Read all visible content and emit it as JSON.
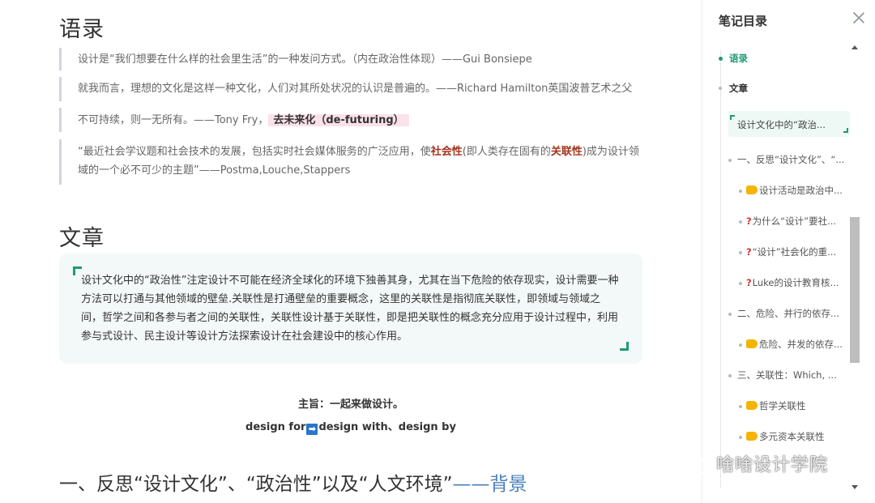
{
  "main": {
    "heading_quotes": "语录",
    "quotes": [
      {
        "text": "设计是“我们想要在什么样的社会里生活”的一种发问方式。（内在政治性体现）——Gui Bonsiepe"
      },
      {
        "text": "就我而言，理想的文化是这样一种文化，人们对其所处状况的认识是普遍的。——Richard Hamilton英国波普艺术之父"
      },
      {
        "pre": "不可持续，则一无所有。——Tony Fry，",
        "highlight": "去未来化（de-futuring）"
      },
      {
        "p1": "“最近社会学议题和社会技术的发展，包括实时社会媒体服务的广泛应用，使",
        "h1": "社会性",
        "p2": "(即人类存在固有的",
        "h2": "关联性",
        "p3": ")成为设计领域的一个必不可少的主题”——Postma,Louche,Stappers"
      }
    ],
    "heading_article": "文章",
    "callout_text": "设计文化中的“政治性”注定设计不可能在经济全球化的环境下独善其身，尤其在当下危险的依存现实，设计需要一种方法可以打通与其他领域的壁垒.关联性是打通壁垒的重要概念，这里的关联性是指彻底关联性，即领域与领域之间，哲学之间和各参与者之间的关联性，关联性设计基于关联性，即是把关联性的概念充分应用于设计过程中，利用参与式设计、民主设计等设计方法探索设计在社会建设中的核心作用。",
    "theme_line": "主旨：一起来做设计。",
    "design_for": "design for",
    "design_arrow": "➡",
    "design_rest": "design with、design by",
    "section_heading": "一、反思“设计文化”、“政治性”以及“人文环境”",
    "section_heading_accent": "——背景"
  },
  "sidebar": {
    "title": "笔记目录",
    "items": [
      {
        "label": "语录",
        "state": "active"
      },
      {
        "label": "文章",
        "state": "bold"
      },
      {
        "label": "设计文化中的“政治..."
      },
      {
        "label": "一、反思“设计文化”、“..."
      },
      {
        "icon": "pointing-hand-icon",
        "label": "设计活动是政治中..."
      },
      {
        "icon": "question-mark-icon",
        "label": "为什么“设计”要社..."
      },
      {
        "icon": "question-mark-icon",
        "label": "“设计”社会化的重..."
      },
      {
        "icon": "question-mark-icon",
        "label": "Luke的设计教育核..."
      },
      {
        "label": "二、危险、并行的依存..."
      },
      {
        "icon": "pointing-hand-icon",
        "label": "危险、并发的依存..."
      },
      {
        "label": "三、关联性：Which, ..."
      },
      {
        "icon": "pointing-hand-icon",
        "label": "哲学关联性"
      },
      {
        "icon": "pointing-hand-icon",
        "label": "多元资本关联性"
      }
    ]
  },
  "watermark": {
    "text": "啥啥设计学院",
    "icon": "wechat-icon"
  },
  "colors": {
    "accent_green": "#1f9b70",
    "accent_blue": "#4a7fb8",
    "highlight_red": "#a3341f",
    "highlight_pink": "#fbe1ea"
  }
}
